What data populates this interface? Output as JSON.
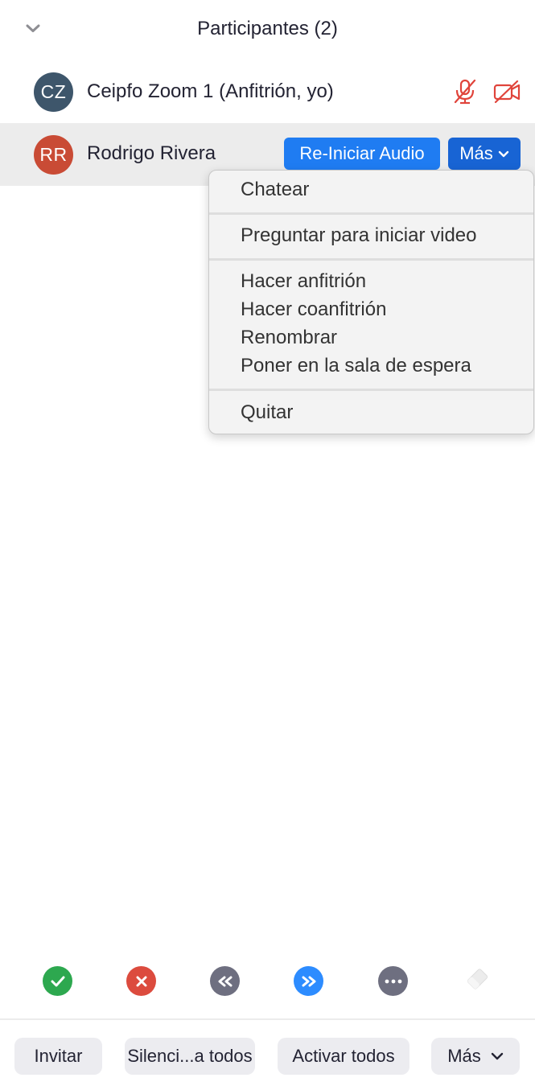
{
  "header": {
    "title": "Participantes (2)",
    "collapse_icon": "chevron-down-icon"
  },
  "participants": [
    {
      "initials": "CZ",
      "name": "Ceipfo Zoom 1 (Anfitrión, yo)",
      "avatar_color": "#3e566b",
      "mic_icon": "mic-muted-icon",
      "video_icon": "video-off-icon",
      "status_color": "#e0443b"
    },
    {
      "initials": "RR",
      "name": "Rodrigo Rivera",
      "avatar_color": "#c94b35",
      "restart_audio_label": "Re-Iniciar Audio",
      "more_label": "Más"
    }
  ],
  "menu": {
    "groups": [
      [
        "Chatear"
      ],
      [
        "Preguntar para iniciar video"
      ],
      [
        "Hacer anfitrión",
        "Hacer coanfitrión",
        "Renombrar",
        "Poner en la sala de espera"
      ],
      [
        "Quitar"
      ]
    ]
  },
  "reactions": [
    {
      "name": "yes",
      "icon": "checkmark-icon",
      "color": "#2da84f"
    },
    {
      "name": "no",
      "icon": "x-icon",
      "color": "#dc4b3e"
    },
    {
      "name": "go-slower",
      "icon": "rewind-icon",
      "color": "#6e6f80"
    },
    {
      "name": "go-faster",
      "icon": "fast-forward-icon",
      "color": "#2d8cff"
    },
    {
      "name": "more",
      "icon": "ellipsis-icon",
      "color": "#6e6f80"
    },
    {
      "name": "clear",
      "icon": "eraser-icon"
    }
  ],
  "footer": {
    "invite_label": "Invitar",
    "mute_all_label": "Silenci...a todos",
    "unmute_all_label": "Activar todos",
    "more_label": "Más"
  },
  "colors": {
    "accent_blue": "#1f7cf2",
    "selected_row": "#ececec",
    "muted_red": "#e0443b"
  }
}
